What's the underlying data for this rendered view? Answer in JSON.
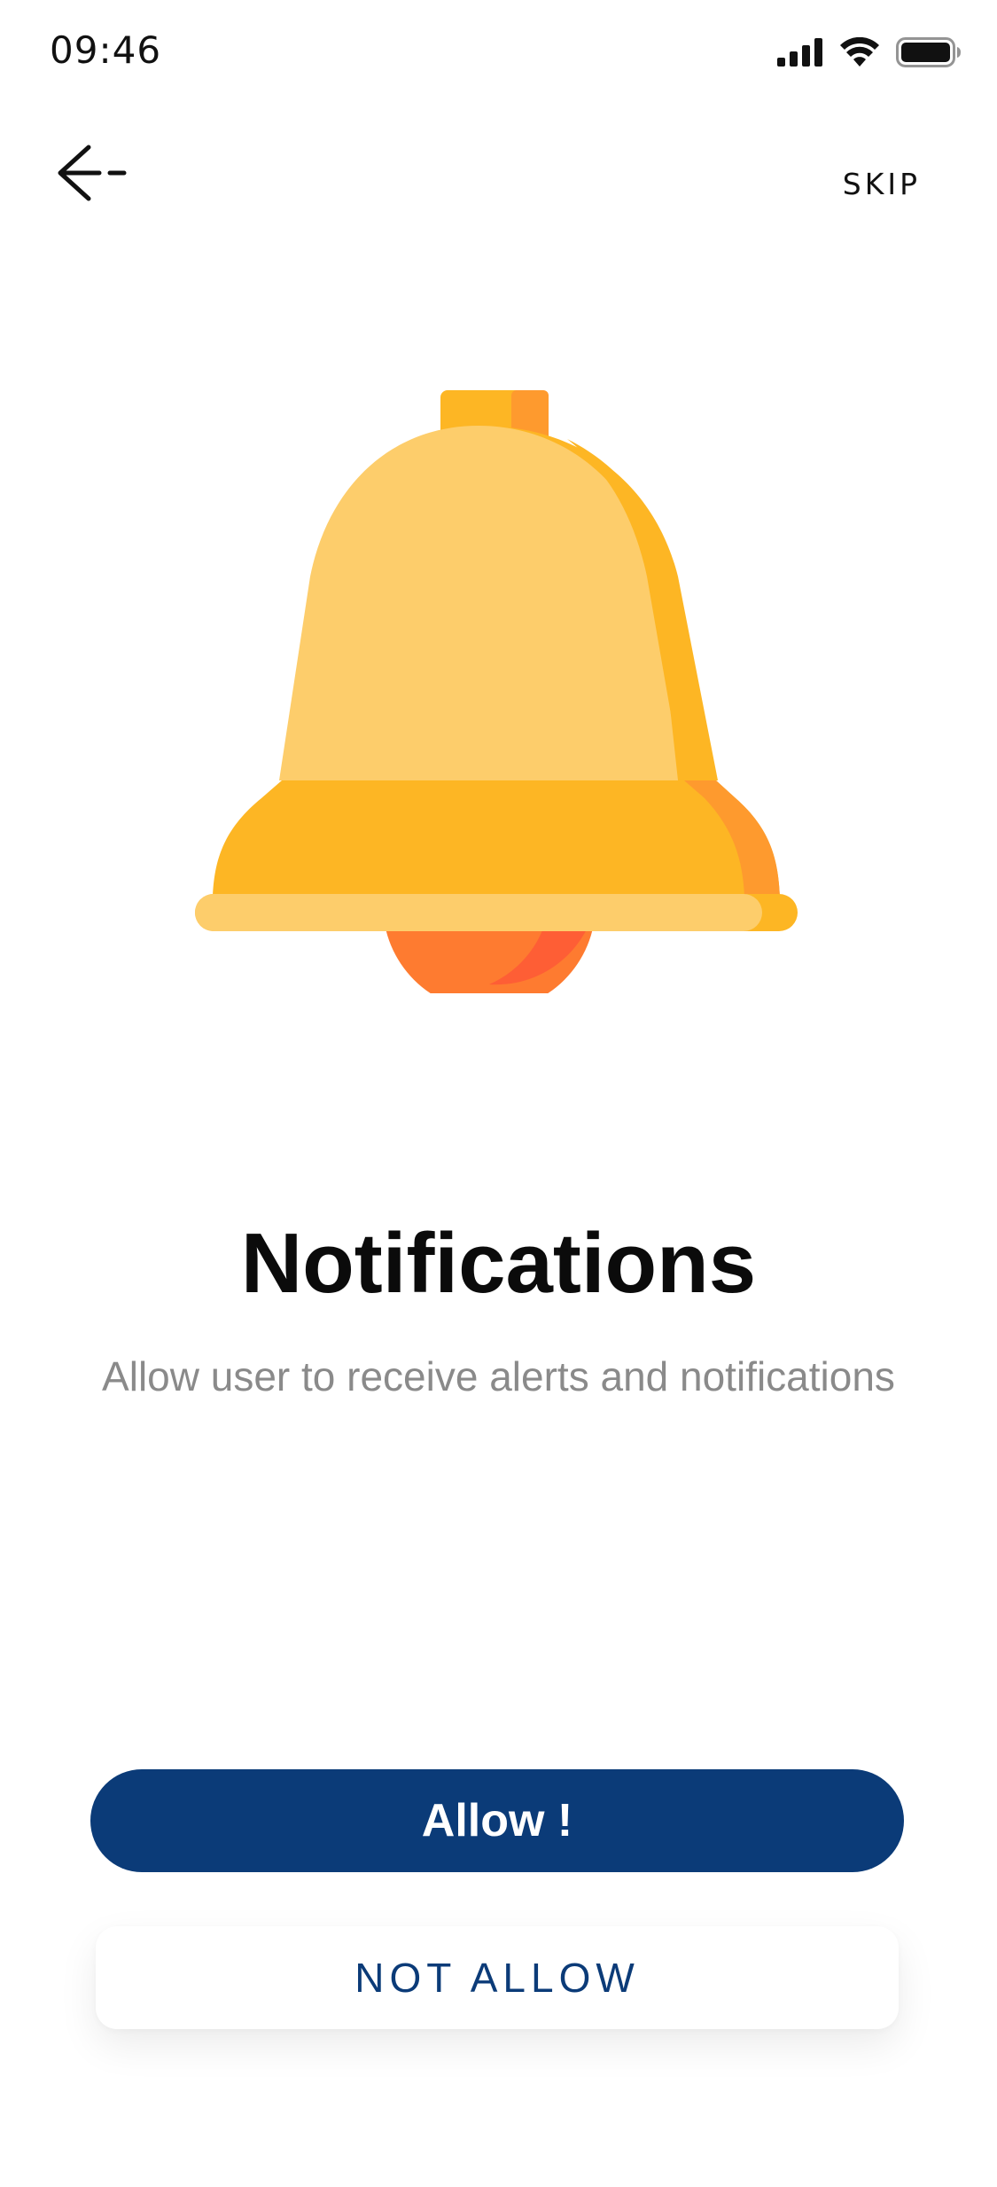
{
  "status_bar": {
    "time": "09:46",
    "icons": [
      "signal-icon",
      "wifi-icon",
      "battery-icon"
    ]
  },
  "nav": {
    "back_icon": "arrow-left-icon",
    "skip_label": "SKIP"
  },
  "illustration": {
    "icon": "bell-icon",
    "colors": {
      "light_yellow": "#FDCD6B",
      "yellow": "#FDB624",
      "orange": "#FE9A2E",
      "clapper": "#FE7B30",
      "clapper_shadow": "#FE5E35"
    }
  },
  "content": {
    "title": "Notifications",
    "subtitle": "Allow user to receive alerts and notifications"
  },
  "actions": {
    "allow_label": "Allow !",
    "not_allow_label": "NOT ALLOW"
  },
  "colors": {
    "primary": "#0B3B78",
    "text_dark": "#0B0B0B",
    "text_muted": "#8A8A8A"
  }
}
